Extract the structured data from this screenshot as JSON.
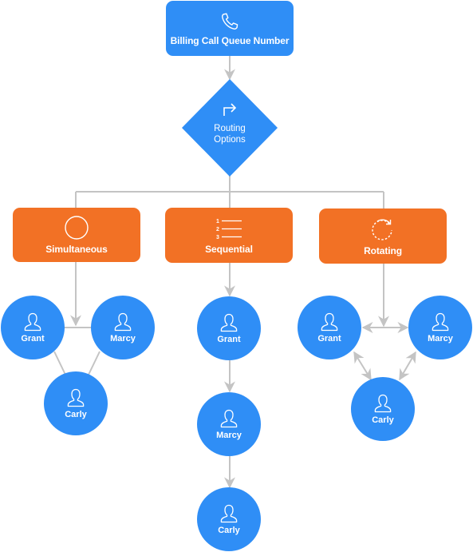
{
  "diagram": {
    "title_node": {
      "label": "Billing Call Queue Number",
      "icon": "phone-icon"
    },
    "decision_node": {
      "label_line1": "Routing",
      "label_line2": "Options",
      "icon": "turn-right-arrow-icon"
    },
    "strategies": [
      {
        "id": "simultaneous",
        "label": "Simultaneous",
        "icon": "circle-icon",
        "members": [
          "Grant",
          "Marcy",
          "Carly"
        ],
        "connection": "all ring together (undirected links)"
      },
      {
        "id": "sequential",
        "label": "Sequential",
        "icon": "numbered-list-icon",
        "list_numbers": [
          "1",
          "2",
          "3"
        ],
        "members": [
          "Grant",
          "Marcy",
          "Carly"
        ],
        "connection": "ordered chain Grant → Marcy → Carly"
      },
      {
        "id": "rotating",
        "label": "Rotating",
        "icon": "rotate-icon",
        "members": [
          "Grant",
          "Marcy",
          "Carly"
        ],
        "connection": "bidirectional rotation among members"
      }
    ],
    "person_icon": "person-icon",
    "colors": {
      "primary_blue": "#2f8ef6",
      "strategy_orange": "#f27125",
      "connector_gray": "#c4c4c4",
      "text_white": "#ffffff"
    }
  }
}
